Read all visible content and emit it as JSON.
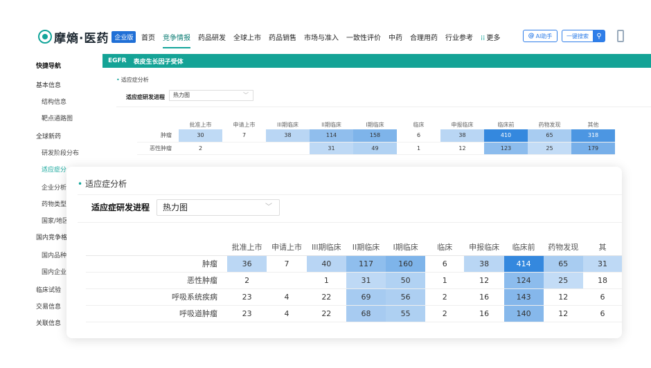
{
  "header": {
    "logo_text": "摩熵·医药",
    "logo_badge": "企业版",
    "nav": [
      "首页",
      "竞争情报",
      "药品研发",
      "全球上市",
      "药品销售",
      "市场与准入",
      "一致性评价",
      "中药",
      "合理用药",
      "行业参考"
    ],
    "nav_active_index": 1,
    "nav_more": "更多",
    "ai_label": "AI助手",
    "search_label": "一键搜索",
    "colors": {
      "accent": "#12a59a",
      "blue": "#2f7ee8"
    }
  },
  "sidebar": {
    "items": [
      {
        "label": "快捷导航",
        "type": "header"
      },
      {
        "label": "基本信息",
        "type": "group"
      },
      {
        "label": "结构信息",
        "type": "sub"
      },
      {
        "label": "靶点通路图",
        "type": "sub"
      },
      {
        "label": "全球新药",
        "type": "group"
      },
      {
        "label": "研发阶段分布",
        "type": "sub"
      },
      {
        "label": "适应症分",
        "type": "sub-active"
      },
      {
        "label": "企业分析",
        "type": "sub"
      },
      {
        "label": "药物类型",
        "type": "sub"
      },
      {
        "label": "国家/地区",
        "type": "sub"
      },
      {
        "label": "国内竞争格",
        "type": "group"
      },
      {
        "label": "国内品种",
        "type": "sub"
      },
      {
        "label": "国内企业",
        "type": "sub"
      },
      {
        "label": "临床试验",
        "type": "group"
      },
      {
        "label": "交易信息",
        "type": "group"
      },
      {
        "label": "关联信息",
        "type": "group"
      }
    ]
  },
  "banner": {
    "target": "EGFR",
    "name": "表皮生长因子受体"
  },
  "background_panel": {
    "section_title": "适应症分析",
    "progress_label": "适应症研发进程",
    "select_value": "热力图",
    "columns": [
      "批准上市",
      "申请上市",
      "III期临床",
      "II期临床",
      "I期临床",
      "临床",
      "申报临床",
      "临床前",
      "药物发现",
      "其他"
    ],
    "rows": [
      {
        "label": "肿瘤",
        "values": [
          "30",
          "7",
          "38",
          "114",
          "158",
          "6",
          "38",
          "410",
          "65",
          "318"
        ]
      },
      {
        "label": "恶性肿瘤",
        "values": [
          "2",
          "",
          "",
          "31",
          "49",
          "1",
          "12",
          "123",
          "25",
          "179"
        ]
      }
    ]
  },
  "zoom_panel": {
    "section_title": "适应症分析",
    "progress_label": "适应症研发进程",
    "select_value": "热力图",
    "columns": [
      "批准上市",
      "申请上市",
      "III期临床",
      "II期临床",
      "I期临床",
      "临床",
      "申报临床",
      "临床前",
      "药物发现",
      "其"
    ],
    "rows": [
      {
        "label": "肿瘤",
        "values": [
          "36",
          "7",
          "40",
          "117",
          "160",
          "6",
          "38",
          "414",
          "65",
          "31"
        ]
      },
      {
        "label": "恶性肿瘤",
        "values": [
          "2",
          "",
          "1",
          "31",
          "50",
          "1",
          "12",
          "124",
          "25",
          "18"
        ]
      },
      {
        "label": "呼吸系统疾病",
        "values": [
          "23",
          "4",
          "22",
          "69",
          "56",
          "2",
          "16",
          "143",
          "12",
          "6"
        ]
      },
      {
        "label": "呼吸道肿瘤",
        "values": [
          "23",
          "4",
          "22",
          "68",
          "55",
          "2",
          "16",
          "140",
          "12",
          "6"
        ]
      }
    ],
    "heat_max": 414
  }
}
